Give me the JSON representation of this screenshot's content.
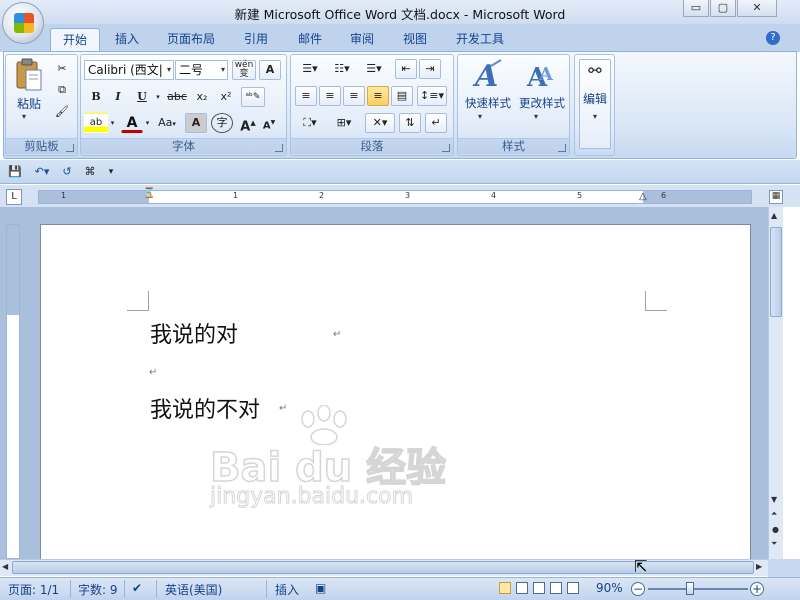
{
  "window": {
    "title": "新建 Microsoft Office Word 文档.docx - Microsoft Word",
    "minimize": "▭",
    "restore": "▢",
    "close": "✕"
  },
  "tabs": [
    "开始",
    "插入",
    "页面布局",
    "引用",
    "邮件",
    "审阅",
    "视图",
    "开发工具"
  ],
  "ribbon": {
    "clipboard": {
      "label": "剪贴板",
      "paste": "粘贴"
    },
    "font": {
      "label": "字体",
      "font_name": "Calibri (西文|",
      "font_size": "二号",
      "bold": "B",
      "italic": "I",
      "underline": "U",
      "strike": "abc",
      "subscript": "x₂",
      "superscript": "x²",
      "grow": "A",
      "shrink": "A",
      "case": "Aa",
      "wen": "wén 变",
      "border_a": "A",
      "shade_a": "A",
      "enclose": "字"
    },
    "paragraph": {
      "label": "段落"
    },
    "styles": {
      "label": "样式",
      "quick_styles": "快速样式",
      "change_styles": "更改样式"
    },
    "editing": {
      "label": "编辑"
    }
  },
  "document": {
    "line1": "我说的对",
    "line2": "我说的不对",
    "para_mark": "↵"
  },
  "watermark": {
    "logo": "Bai du 经验",
    "url": "jingyan.baidu.com"
  },
  "ruler_numbers": [
    "1",
    "2",
    "1",
    "2",
    "3",
    "4",
    "5",
    "6"
  ],
  "statusbar": {
    "page": "页面: 1/1",
    "words": "字数: 9",
    "language": "英语(美国)",
    "insert": "插入",
    "zoom": "90%"
  },
  "colors": {
    "accent": "#15428b",
    "ribbon_bg": "#dbe7f6",
    "highlight": "#fbcf5e"
  }
}
